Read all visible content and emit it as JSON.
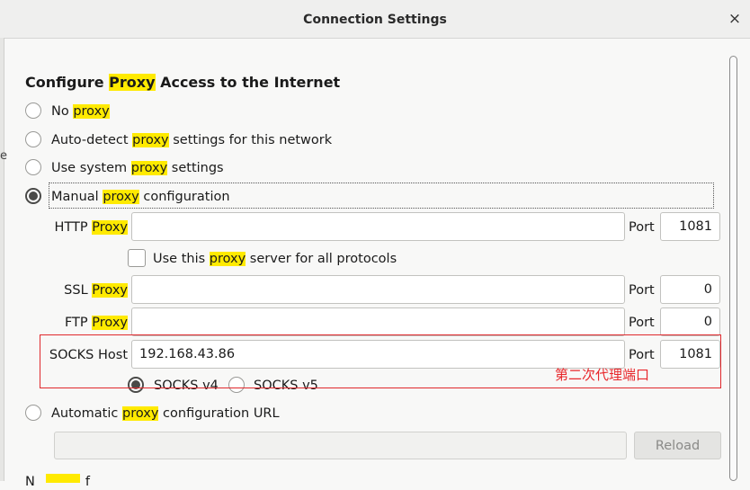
{
  "window": {
    "title": "Connection Settings",
    "close_glyph": "×"
  },
  "left_edge_char": "e",
  "section": {
    "heading_pre": "Configure ",
    "heading_hl": "Proxy",
    "heading_post": " Access to the Internet"
  },
  "proxy_modes": [
    {
      "pre": "No ",
      "hl": "proxy",
      "post": "",
      "selected": false
    },
    {
      "pre": "Auto-detect ",
      "hl": "proxy",
      "post": " settings for this network",
      "selected": false
    },
    {
      "pre": "Use system ",
      "hl": "proxy",
      "post": " settings",
      "selected": false
    },
    {
      "pre": "Manual ",
      "hl": "proxy",
      "post": " configuration",
      "selected": true
    }
  ],
  "http": {
    "label_pre": "HTTP ",
    "label_hl": "Proxy",
    "value": "",
    "port_label": "Port",
    "port": "1081"
  },
  "use_all": {
    "pre": "Use this ",
    "hl": "proxy",
    "post": " server for all protocols",
    "checked": false
  },
  "ssl": {
    "label_pre": "SSL ",
    "label_hl": "Proxy",
    "value": "",
    "port_label": "Port",
    "port": "0"
  },
  "ftp": {
    "label_pre": "FTP ",
    "label_hl": "Proxy",
    "value": "",
    "port_label": "Port",
    "port": "0"
  },
  "socks": {
    "label": "SOCKS Host",
    "value": "192.168.43.86",
    "port_label": "Port",
    "port": "1081"
  },
  "socks_versions": [
    {
      "label": "SOCKS v4",
      "selected": true
    },
    {
      "label": "SOCKS v5",
      "selected": false
    }
  ],
  "annotation": "第二次代理端口",
  "auto_url": {
    "pre": "Automatic ",
    "hl": "proxy",
    "post": " configuration URL",
    "selected": false,
    "value": ""
  },
  "reload_label": "Reload",
  "cutoff": {
    "pre": "N",
    "hl": "",
    "post": "f"
  },
  "colors": {
    "highlight": "#ffea00",
    "annotation": "#e8272b"
  }
}
